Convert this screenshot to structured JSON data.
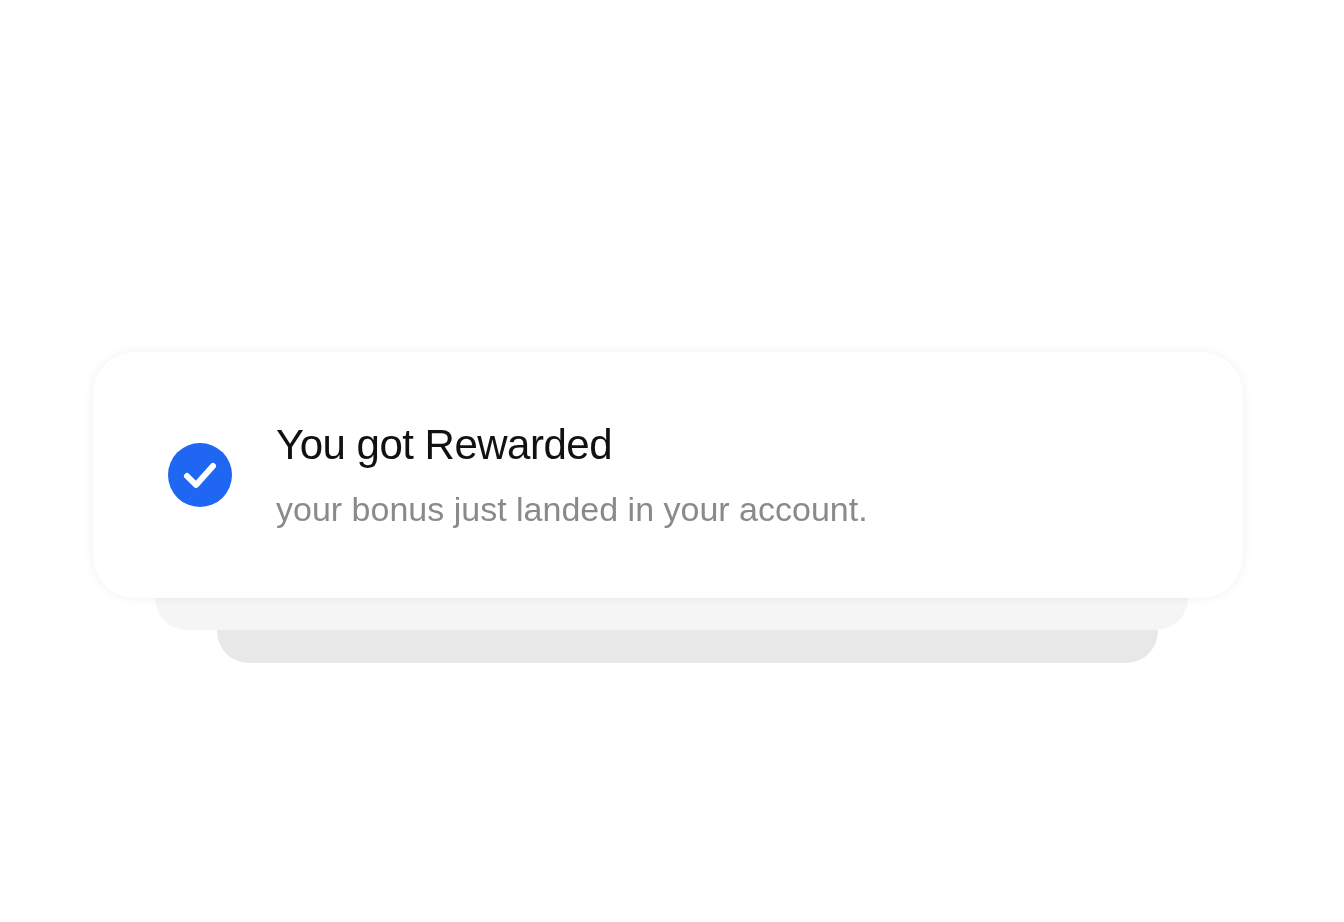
{
  "notification": {
    "kind": "success",
    "title": "You got Rewarded",
    "message": "your bonus just landed in your account."
  }
}
